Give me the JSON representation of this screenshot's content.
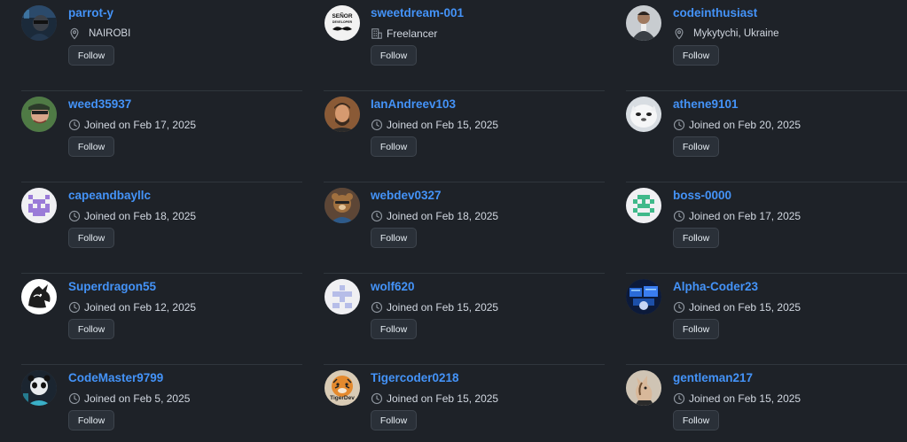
{
  "follow_label": "Follow",
  "users": [
    {
      "username": "parrot-y",
      "meta": "NAIROBI",
      "meta_icon": "location-icon"
    },
    {
      "username": "sweetdream-001",
      "meta": "Freelancer",
      "meta_icon": "organization-icon",
      "avatar_text_top": "SEÑOR",
      "avatar_text_bottom": "DEVELOPER"
    },
    {
      "username": "codeinthusiast",
      "meta": "Mykytychi, Ukraine",
      "meta_icon": "location-icon"
    },
    {
      "username": "weed35937",
      "meta": "Joined on Feb 17, 2025",
      "meta_icon": "clock-icon"
    },
    {
      "username": "IanAndreev103",
      "meta": "Joined on Feb 15, 2025",
      "meta_icon": "clock-icon"
    },
    {
      "username": "athene9101",
      "meta": "Joined on Feb 20, 2025",
      "meta_icon": "clock-icon"
    },
    {
      "username": "capeandbayllc",
      "meta": "Joined on Feb 18, 2025",
      "meta_icon": "clock-icon"
    },
    {
      "username": "webdev0327",
      "meta": "Joined on Feb 18, 2025",
      "meta_icon": "clock-icon"
    },
    {
      "username": "boss-0000",
      "meta": "Joined on Feb 17, 2025",
      "meta_icon": "clock-icon"
    },
    {
      "username": "Superdragon55",
      "meta": "Joined on Feb 12, 2025",
      "meta_icon": "clock-icon"
    },
    {
      "username": "wolf620",
      "meta": "Joined on Feb 15, 2025",
      "meta_icon": "clock-icon"
    },
    {
      "username": "Alpha-Coder23",
      "meta": "Joined on Feb 15, 2025",
      "meta_icon": "clock-icon"
    },
    {
      "username": "CodeMaster9799",
      "meta": "Joined on Feb 5, 2025",
      "meta_icon": "clock-icon"
    },
    {
      "username": "Tigercoder0218",
      "meta": "Joined on Feb 15, 2025",
      "meta_icon": "clock-icon",
      "avatar_text": "TigerDev"
    },
    {
      "username": "gentleman217",
      "meta": "Joined on Feb 15, 2025",
      "meta_icon": "clock-icon"
    }
  ]
}
